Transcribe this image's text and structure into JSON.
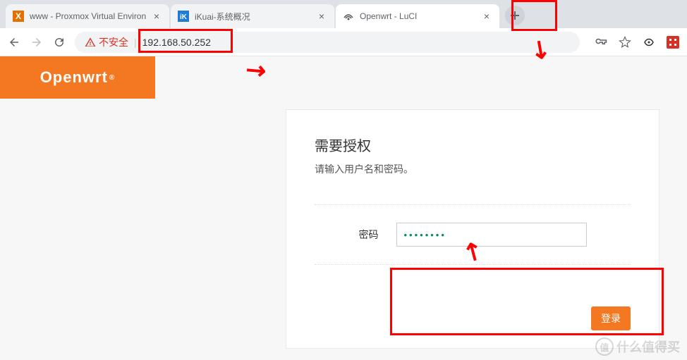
{
  "tabs": [
    {
      "title": "www - Proxmox Virtual Environ",
      "favicon": "proxmox"
    },
    {
      "title": "iKuai-系统概况",
      "favicon": "ikuai"
    },
    {
      "title": "Openwrt - LuCI",
      "favicon": "openwrt"
    }
  ],
  "toolbar": {
    "not_secure": "不安全",
    "url": "192.168.50.252"
  },
  "brand": "Openwrt",
  "login": {
    "title": "需要授权",
    "subtitle": "请输入用户名和密码。",
    "password_label": "密码",
    "password_value": "••••••••",
    "button": "登录"
  },
  "watermark": {
    "icon": "值",
    "text": "什么值得买"
  }
}
